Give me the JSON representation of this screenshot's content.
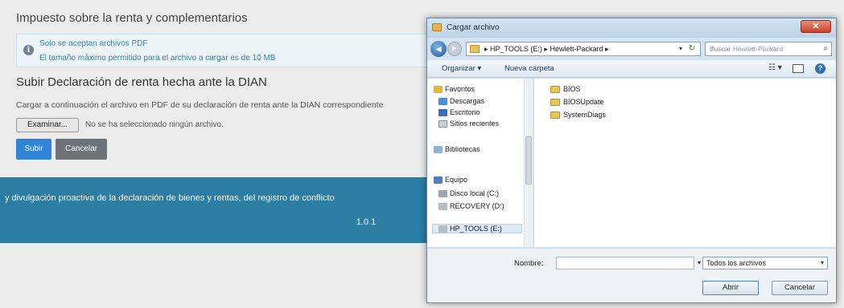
{
  "page": {
    "title": "Impuesto sobre la renta y complementarios",
    "info": {
      "line1": "Solo se aceptan archivos PDF",
      "line2": "El tamaño máximo permitido para el archivo a cargar es de 10 MB"
    },
    "section_title": "Subir Declaración de renta hecha ante la DIAN",
    "section_desc": "Cargar a continuación el archivo en PDF de su declaración de renta ante la DIAN correspondiente",
    "file_button": "Examinar...",
    "file_status": "No se ha seleccionado ningún archivo.",
    "submit_label": "Subir",
    "cancel_label": "Cancelar",
    "footer_line1": "y divulgación proactiva de la declaración de bienes y rentas, del registro de conflicto",
    "footer_version": "1.0.1"
  },
  "dialog": {
    "title": "Cargar archivo",
    "close_label": "✕",
    "address": {
      "path": [
        "HP_TOOLS (E:)",
        "Hewlett-Packard"
      ],
      "separator": "▸"
    },
    "search_placeholder": "Buscar Hewlett-Packard",
    "toolbar": {
      "organize": "Organizar ▾",
      "new_folder": "Nueva carpeta"
    },
    "nav": {
      "favorites": "Favoritos",
      "downloads": "Descargas",
      "desktop": "Escritorio",
      "recent": "Sitios recientes",
      "libraries": "Bibliotecas",
      "computer": "Equipo",
      "local_disk": "Disco local (C:)",
      "recovery": "RECOVERY (D:)",
      "hp_tools": "HP_TOOLS (E:)"
    },
    "files": [
      "BIOS",
      "BIOSUpdate",
      "SystemDiags"
    ],
    "name_label": "Nombre:",
    "name_value": "",
    "filetype": "Todos los archivos",
    "open_label": "Abrir",
    "cancel_label": "Cancelar"
  },
  "colors": {
    "primary": "#2f84d8",
    "secondary": "#6c7378",
    "footer": "#2b7da4"
  }
}
